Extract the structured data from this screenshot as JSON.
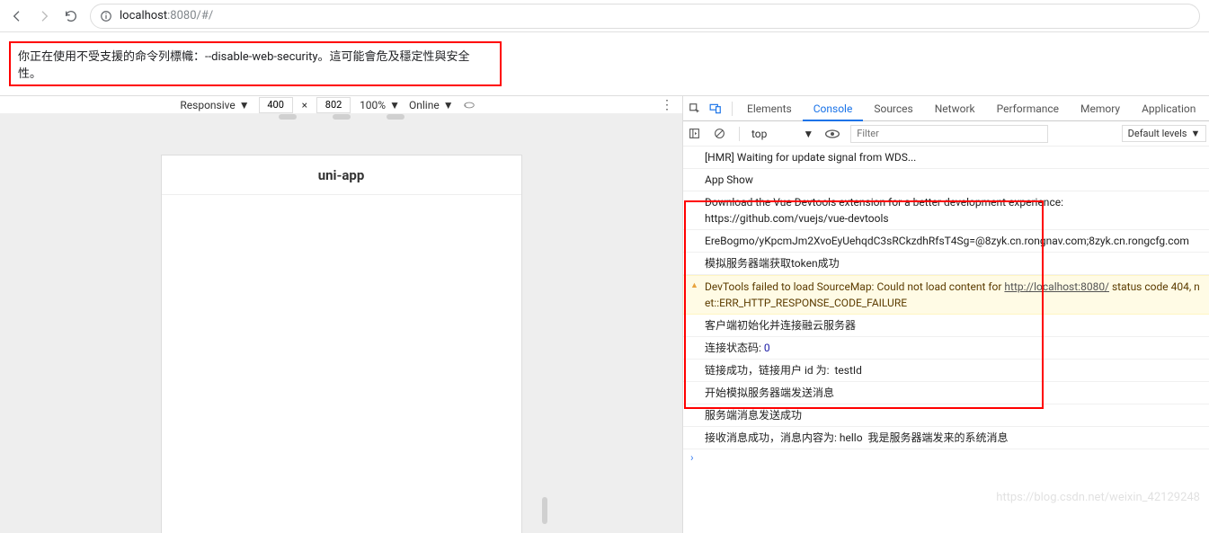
{
  "browser": {
    "url_host": "localhost",
    "url_port_path": ":8080/#/"
  },
  "warning_bar": "你正在使用不受支援的命令列標幟：--disable-web-security。這可能會危及穩定性與安全性。",
  "device_bar": {
    "mode": "Responsive",
    "width": "400",
    "height": "802",
    "zoom": "100%",
    "throttle": "Online"
  },
  "preview": {
    "title": "uni-app"
  },
  "devtools": {
    "tabs": [
      "Elements",
      "Console",
      "Sources",
      "Network",
      "Performance",
      "Memory",
      "Application"
    ],
    "active_tab": "Console",
    "context": "top",
    "filter_placeholder": "Filter",
    "levels_label": "Default levels",
    "logs": [
      {
        "type": "log",
        "text": "[HMR] Waiting for update signal from WDS..."
      },
      {
        "type": "log",
        "text": "App Show"
      },
      {
        "type": "log",
        "text": "Download the Vue Devtools extension for a better development experience:\nhttps://github.com/vuejs/vue-devtools"
      },
      {
        "type": "log",
        "text": "EreBogmo/yKpcmJm2XvoEyUehqdC3sRCkzdhRfsT4Sg=@8zyk.cn.rongnav.com;8zyk.cn.rongcfg.com"
      },
      {
        "type": "log",
        "text": "模拟服务器端获取token成功"
      },
      {
        "type": "warn",
        "text": "DevTools failed to load SourceMap: Could not load content for http://localhost:8080/ status code 404, net::ERR_HTTP_RESPONSE_CODE_FAILURE"
      },
      {
        "type": "log",
        "text": "客户端初始化并连接融云服务器"
      },
      {
        "type": "log",
        "text": "连接状态码: ",
        "num": "0"
      },
      {
        "type": "log",
        "text": "链接成功，链接用户 id 为:  testId"
      },
      {
        "type": "log",
        "text": "开始模拟服务器端发送消息"
      },
      {
        "type": "log",
        "text": "服务端消息发送成功"
      },
      {
        "type": "log",
        "text": "接收消息成功，消息内容为: hello  我是服务器端发来的系统消息"
      }
    ]
  },
  "watermark": "https://blog.csdn.net/weixin_42129248"
}
